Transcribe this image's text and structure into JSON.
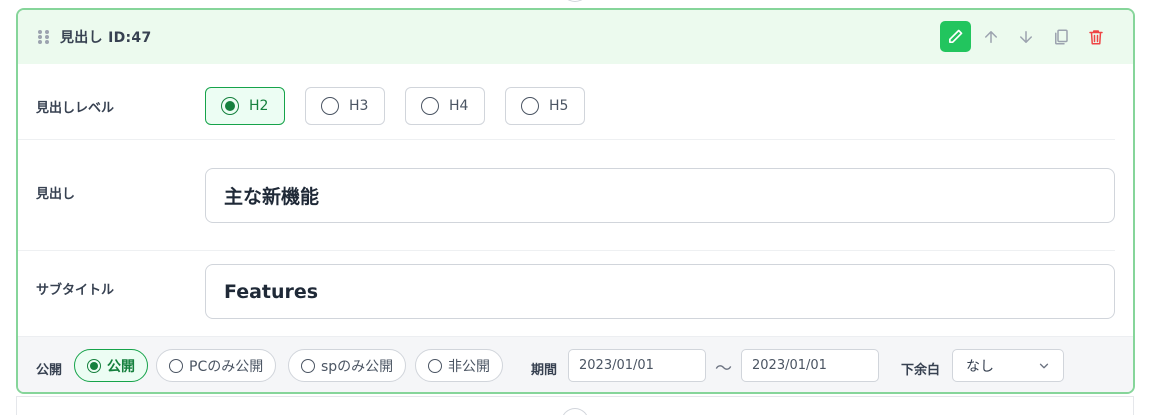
{
  "block": {
    "title": "見出し ID:47",
    "accent_color": "#22c55e",
    "delete_color": "#ef4444",
    "actions": [
      "pencil-icon",
      "arrow-up-icon",
      "arrow-down-icon",
      "copy-icon",
      "trash-icon"
    ]
  },
  "heading_level": {
    "label": "見出しレベル",
    "options": [
      "H2",
      "H3",
      "H4",
      "H5"
    ],
    "selected": "H2"
  },
  "heading": {
    "label": "見出し",
    "value": "主な新機能"
  },
  "subtitle": {
    "label": "サブタイトル",
    "value": "Features"
  },
  "footer": {
    "publish_label": "公開",
    "publish_options": [
      "公開",
      "PCのみ公開",
      "spのみ公開",
      "非公開"
    ],
    "publish_selected": "公開",
    "period_label": "期間",
    "period_start": "2023/01/01",
    "period_separator": "〜",
    "period_end": "2023/01/01",
    "margin_label": "下余白",
    "margin_value": "なし"
  }
}
